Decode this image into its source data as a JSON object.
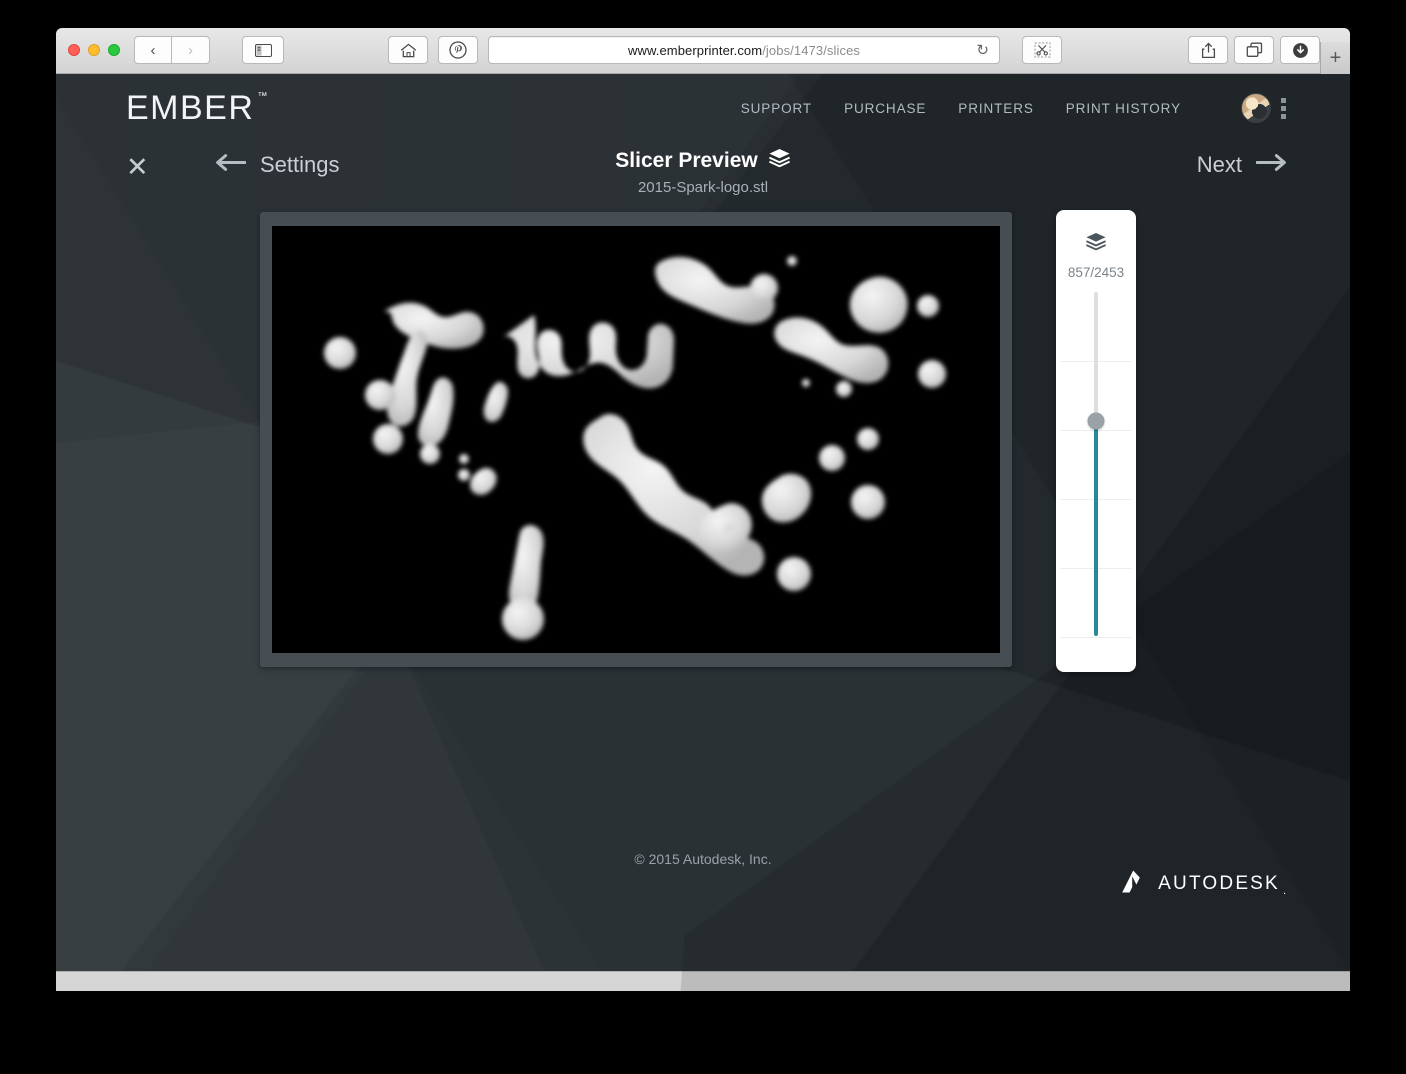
{
  "browser": {
    "url_domain": "www.emberprinter.com",
    "url_path": "/jobs/1473/slices",
    "back_icon": "‹",
    "forward_icon": "›",
    "sidebar_icon": "sidebar",
    "home_icon": "⌂",
    "pinterest_icon": "P",
    "reload_icon": "↻",
    "scissors_icon": "✂",
    "share_icon": "share",
    "tabs_icon": "tabs",
    "download_icon": "download",
    "newtab_label": "+"
  },
  "site_header": {
    "logo": "EMBER",
    "logo_tm": "™",
    "nav": [
      {
        "label": "SUPPORT"
      },
      {
        "label": "PURCHASE"
      },
      {
        "label": "PRINTERS"
      },
      {
        "label": "PRINT HISTORY"
      }
    ]
  },
  "app_bar": {
    "close_label": "✕",
    "back_label": "Settings",
    "title": "Slicer Preview",
    "file_name": "2015-Spark-logo.stl",
    "next_label": "Next"
  },
  "layer_panel": {
    "current_layer": 857,
    "total_layers": 2453,
    "counter_label": "857/2453",
    "track_color": "#2a879b",
    "track_empty_color": "#dcdedf",
    "handle_color": "#9aa2a7"
  },
  "footer": {
    "copyright": "© 2015 Autodesk, Inc.",
    "brand": "AUTODESK"
  },
  "theme": {
    "page_bg": "#272e32",
    "accent": "#2a879b",
    "frame": "#474e53",
    "canvas_bg": "#000000"
  }
}
